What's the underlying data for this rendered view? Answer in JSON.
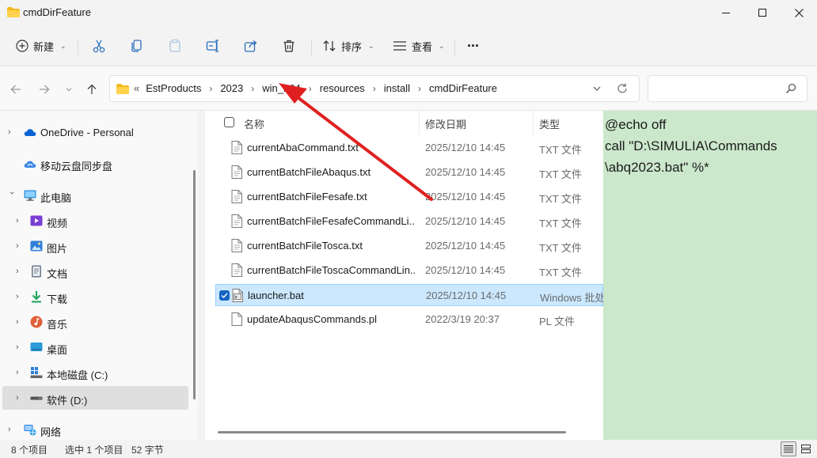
{
  "window": {
    "title": "cmdDirFeature"
  },
  "toolbar": {
    "new_label": "新建",
    "sort_label": "排序",
    "view_label": "查看",
    "more_label": "···"
  },
  "address": {
    "overflow": "«",
    "crumbs": [
      "EstProducts",
      "2023",
      "win_b64",
      "resources",
      "install",
      "cmdDirFeature"
    ]
  },
  "search": {
    "placeholder": ""
  },
  "sidebar": {
    "items": [
      {
        "label": "OneDrive - Personal",
        "icon": "cloud-icon",
        "color": "#0a64d6"
      },
      {
        "label": "移动云盘同步盘",
        "icon": "cloud-sync-icon",
        "color": "#2b6fd6"
      },
      {
        "label": "此电脑",
        "icon": "computer-icon",
        "color": "#2d8fd8"
      },
      {
        "label": "视频",
        "icon": "video-icon",
        "color": "#7b3fd4"
      },
      {
        "label": "图片",
        "icon": "pictures-icon",
        "color": "#2f7fd8"
      },
      {
        "label": "文档",
        "icon": "documents-icon",
        "color": "#6d7a88"
      },
      {
        "label": "下载",
        "icon": "download-icon",
        "color": "#18a058"
      },
      {
        "label": "音乐",
        "icon": "music-icon",
        "color": "#e0603a"
      },
      {
        "label": "桌面",
        "icon": "desktop-icon",
        "color": "#2a9ad8"
      },
      {
        "label": "本地磁盘 (C:)",
        "icon": "windows-drive-icon",
        "color": "#2a7fd8"
      },
      {
        "label": "软件 (D:)",
        "icon": "drive-icon",
        "color": "#555555"
      },
      {
        "label": "网络",
        "icon": "network-icon",
        "color": "#2a7fd8"
      }
    ]
  },
  "columns": {
    "name": "名称",
    "date": "修改日期",
    "type": "类型"
  },
  "files": [
    {
      "name": "currentAbaCommand.txt",
      "date": "2025/12/10 14:45",
      "type": "TXT 文件"
    },
    {
      "name": "currentBatchFileAbaqus.txt",
      "date": "2025/12/10 14:45",
      "type": "TXT 文件"
    },
    {
      "name": "currentBatchFileFesafe.txt",
      "date": "2025/12/10 14:45",
      "type": "TXT 文件"
    },
    {
      "name": "currentBatchFileFesafeCommandLi...",
      "date": "2025/12/10 14:45",
      "type": "TXT 文件"
    },
    {
      "name": "currentBatchFileTosca.txt",
      "date": "2025/12/10 14:45",
      "type": "TXT 文件"
    },
    {
      "name": "currentBatchFileToscaCommandLin...",
      "date": "2025/12/10 14:45",
      "type": "TXT 文件"
    },
    {
      "name": "launcher.bat",
      "date": "2025/12/10 14:45",
      "type": "Windows 批处",
      "selected": true
    },
    {
      "name": "updateAbaqusCommands.pl",
      "date": "2022/3/19 20:37",
      "type": "PL 文件"
    }
  ],
  "preview": {
    "lines": [
      "@echo off",
      "call \"D:\\SIMULIA\\Commands",
      "\\abq2023.bat\" %*"
    ],
    "background": "#cce8cc"
  },
  "status": {
    "count": "8 个项目",
    "selection": "选中 1 个项目",
    "size": "52 字节"
  },
  "annotation": {
    "arrow_color": "#e02020"
  }
}
